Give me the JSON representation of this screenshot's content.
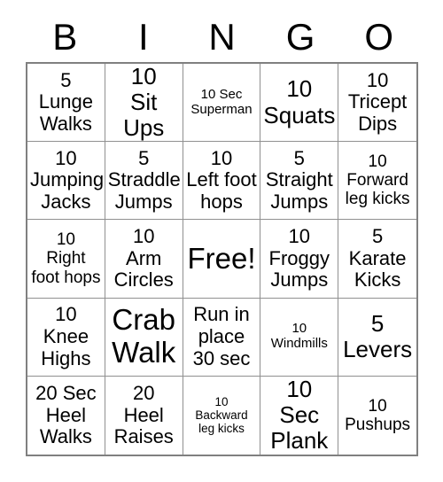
{
  "card": {
    "title_letters": [
      "B",
      "I",
      "N",
      "G",
      "O"
    ],
    "cells": [
      {
        "text": "5\nLunge\nWalks",
        "size": "s-md"
      },
      {
        "text": "10\nSit Ups",
        "size": "s-lg"
      },
      {
        "text": "10 Sec\nSuperman",
        "size": "s-xs"
      },
      {
        "text": "10\nSquats",
        "size": "s-lg"
      },
      {
        "text": "10\nTricept\nDips",
        "size": "s-md"
      },
      {
        "text": "10\nJumping\nJacks",
        "size": "s-md"
      },
      {
        "text": "5\nStraddle\nJumps",
        "size": "s-md"
      },
      {
        "text": "10\nLeft foot\nhops",
        "size": "s-md"
      },
      {
        "text": "5\nStraight\nJumps",
        "size": "s-md"
      },
      {
        "text": "10\nForward\nleg kicks",
        "size": "s-sm"
      },
      {
        "text": "10\nRight\nfoot hops",
        "size": "s-sm"
      },
      {
        "text": "10\nArm\nCircles",
        "size": "s-md"
      },
      {
        "text": "Free!",
        "size": "s-xl"
      },
      {
        "text": "10\nFroggy\nJumps",
        "size": "s-md"
      },
      {
        "text": "5\nKarate\nKicks",
        "size": "s-md"
      },
      {
        "text": "10\nKnee\nHighs",
        "size": "s-md"
      },
      {
        "text": "Crab\nWalk",
        "size": "s-xl"
      },
      {
        "text": "Run in\nplace\n30 sec",
        "size": "s-md"
      },
      {
        "text": "10\nWindmills",
        "size": "s-xs"
      },
      {
        "text": "5\nLevers",
        "size": "s-lg"
      },
      {
        "text": "20 Sec\nHeel\nWalks",
        "size": "s-md"
      },
      {
        "text": "20\nHeel\nRaises",
        "size": "s-md"
      },
      {
        "text": "10\nBackward\nleg kicks",
        "size": "s-xxs"
      },
      {
        "text": "10 Sec\nPlank",
        "size": "s-lg"
      },
      {
        "text": "10\nPushups",
        "size": "s-sm"
      }
    ],
    "colors": {
      "background": "#ffffff",
      "text": "#000000",
      "grid_line": "#909090",
      "grid_border": "#808080"
    }
  }
}
